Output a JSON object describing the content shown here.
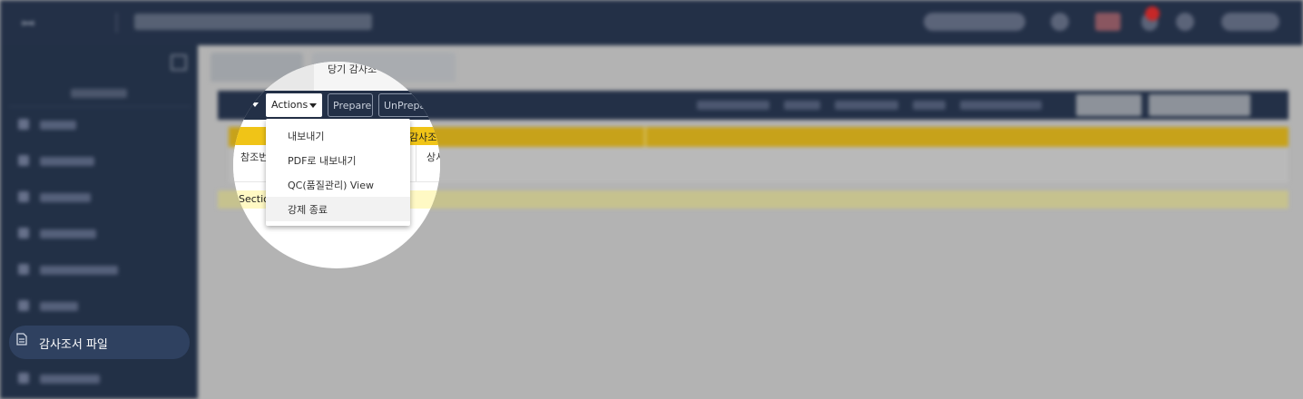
{
  "sidebar": {
    "active_item": {
      "label": "감사조서 파일",
      "icon": "file-icon"
    }
  },
  "lens": {
    "tab_label": "당기 감사조",
    "actions_label": "Actions",
    "prepare_label": "Prepare",
    "unprepare_label": "UnPrepa",
    "grid_header_fragment": "감사조",
    "col_ref_fragment": "참조번",
    "col_detail_fragment": "상서",
    "section_fragment": "Section",
    "menu_items": [
      "내보내기",
      "PDF로 내보내기",
      "QC(품질관리) View",
      "강제 종료"
    ]
  },
  "colors": {
    "topbar": "#233047",
    "sidebar": "#223046",
    "active_item": "#2f4160",
    "grid_header": "#f0c417",
    "section_row": "#fff9c4",
    "badge": "#c62828"
  }
}
